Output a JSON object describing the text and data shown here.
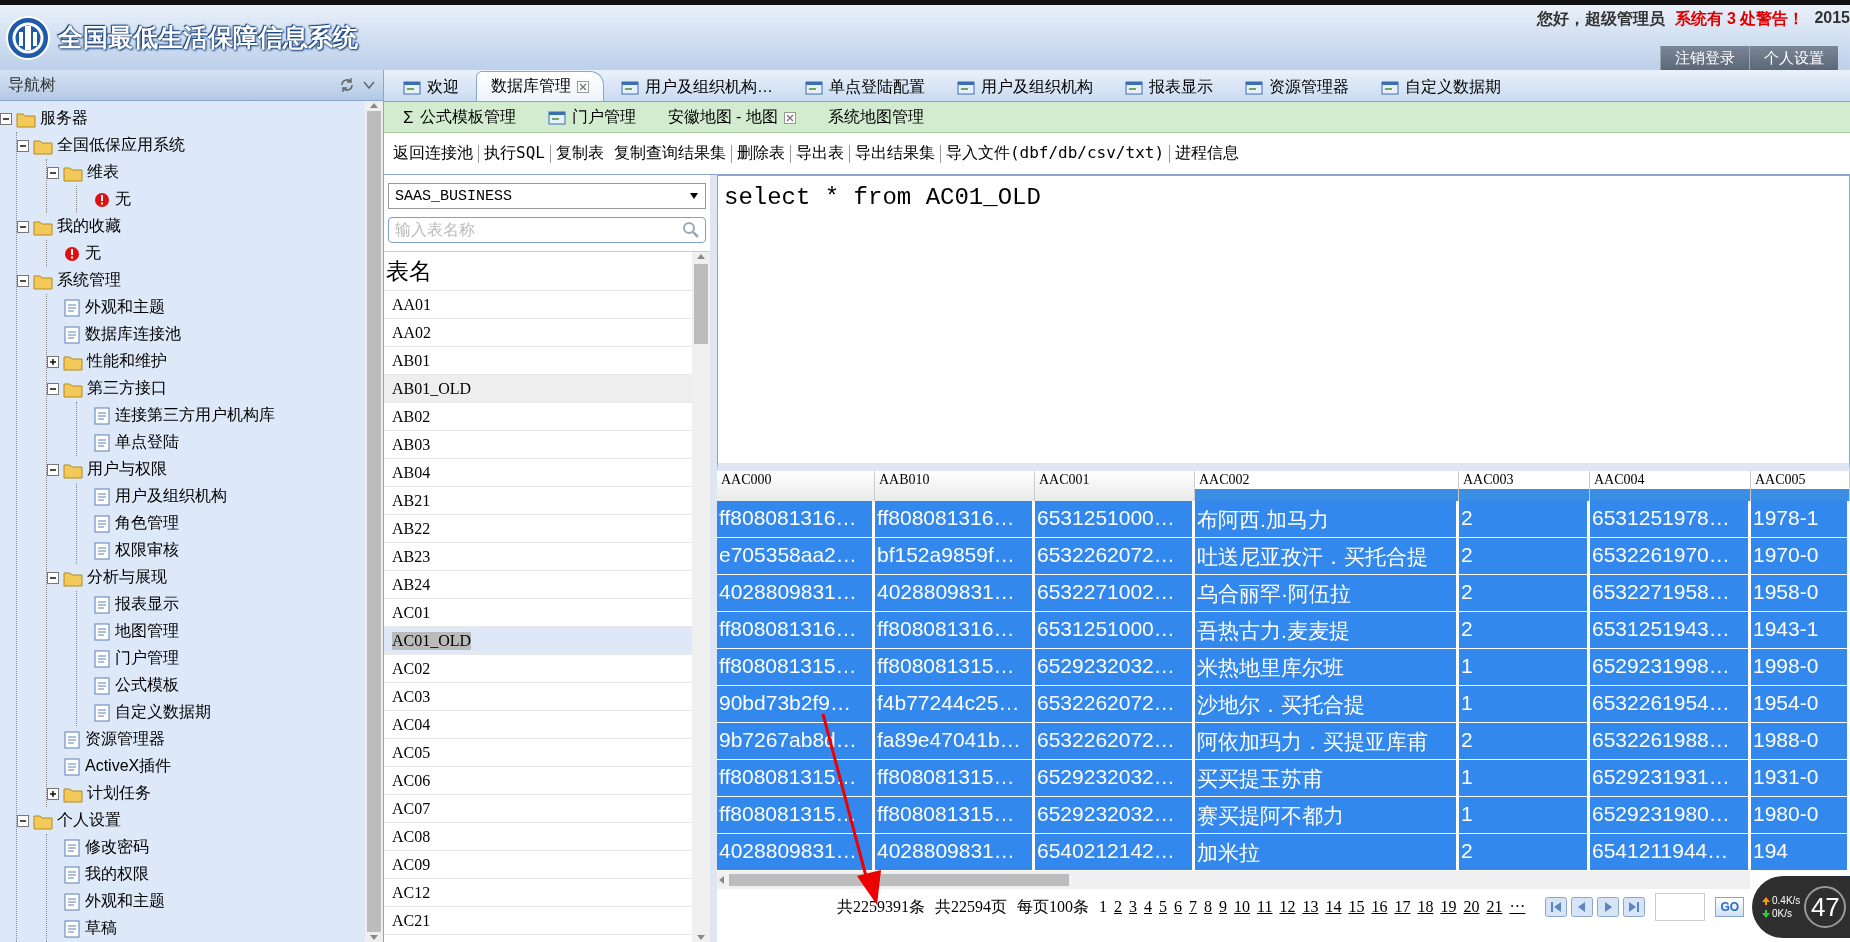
{
  "header": {
    "title": "全国最低生活保障信息系统",
    "greeting": "您好，超级管理员",
    "warning": "系统有 3 处警告！",
    "year": "2015",
    "buttons": [
      "注销登录",
      "个人设置"
    ]
  },
  "nav": {
    "title": "导航树",
    "tree": [
      {
        "label": "服务器",
        "expanded": true,
        "children": [
          {
            "label": "全国低保应用系统",
            "expanded": true,
            "children": [
              {
                "label": "维表",
                "expanded": true,
                "children": [
                  {
                    "label": "无",
                    "kind": "warning"
                  }
                ]
              }
            ]
          },
          {
            "label": "我的收藏",
            "expanded": true,
            "children": [
              {
                "label": "无",
                "kind": "warning"
              }
            ]
          },
          {
            "label": "系统管理",
            "expanded": true,
            "children": [
              {
                "label": "外观和主题"
              },
              {
                "label": "数据库连接池"
              },
              {
                "label": "性能和维护",
                "expanded": false
              },
              {
                "label": "第三方接口",
                "expanded": true,
                "children": [
                  {
                    "label": "连接第三方用户机构库"
                  },
                  {
                    "label": "单点登陆"
                  }
                ]
              },
              {
                "label": "用户与权限",
                "expanded": true,
                "children": [
                  {
                    "label": "用户及组织机构"
                  },
                  {
                    "label": "角色管理"
                  },
                  {
                    "label": "权限审核"
                  }
                ]
              },
              {
                "label": "分析与展现",
                "expanded": true,
                "children": [
                  {
                    "label": "报表显示"
                  },
                  {
                    "label": "地图管理"
                  },
                  {
                    "label": "门户管理"
                  },
                  {
                    "label": "公式模板"
                  },
                  {
                    "label": "自定义数据期"
                  }
                ]
              },
              {
                "label": "资源管理器"
              },
              {
                "label": "ActiveX插件"
              },
              {
                "label": "计划任务",
                "expanded": false
              }
            ]
          },
          {
            "label": "个人设置",
            "expanded": true,
            "children": [
              {
                "label": "修改密码"
              },
              {
                "label": "我的权限"
              },
              {
                "label": "外观和主题"
              },
              {
                "label": "草稿"
              }
            ]
          }
        ]
      }
    ]
  },
  "tabs": [
    {
      "label": "欢迎",
      "selected": false,
      "has_icon": true,
      "closable": false
    },
    {
      "label": "数据库管理",
      "selected": true,
      "has_icon": false,
      "closable": true
    },
    {
      "label": "用户及组织机构…",
      "selected": false,
      "has_icon": true,
      "closable": false
    },
    {
      "label": "单点登陆配置",
      "selected": false,
      "has_icon": true,
      "closable": false
    },
    {
      "label": "用户及组织机构",
      "selected": false,
      "has_icon": true,
      "closable": false
    },
    {
      "label": "报表显示",
      "selected": false,
      "has_icon": true,
      "closable": false
    },
    {
      "label": "资源管理器",
      "selected": false,
      "has_icon": true,
      "closable": false
    },
    {
      "label": "自定义数据期",
      "selected": false,
      "has_icon": true,
      "closable": false
    }
  ],
  "subtabs": [
    {
      "glyph": "Σ",
      "label": "公式模板管理",
      "selected": false,
      "has_icon": false,
      "closable": false
    },
    {
      "label": "门户管理",
      "selected": false,
      "has_icon": true,
      "closable": false
    },
    {
      "label": "安徽地图 - 地图",
      "selected": false,
      "has_icon": false,
      "closable": true
    },
    {
      "label": "系统地图管理",
      "selected": false,
      "has_icon": false,
      "closable": false
    }
  ],
  "toolbar": [
    {
      "label": "返回连接池",
      "divider_after": true
    },
    {
      "label": "执行SQL",
      "divider_after": true
    },
    {
      "label": "复制表",
      "divider_after": false
    },
    {
      "label": "复制查询结果集",
      "divider_after": true
    },
    {
      "label": "删除表",
      "divider_after": true
    },
    {
      "label": "导出表",
      "divider_after": true
    },
    {
      "label": "导出结果集",
      "divider_after": true
    },
    {
      "label": "导入文件(dbf/db/csv/txt)",
      "divider_after": true
    },
    {
      "label": "进程信息",
      "divider_after": false
    }
  ],
  "table_list": {
    "database": "SAAS_BUSINESS",
    "search": {
      "placeholder": "输入表名称"
    },
    "header": "表名",
    "items": [
      {
        "name": "AA01",
        "selected": false,
        "hovered": false
      },
      {
        "name": "AA02",
        "selected": false,
        "hovered": false
      },
      {
        "name": "AB01",
        "selected": false,
        "hovered": false
      },
      {
        "name": "AB01_OLD",
        "selected": false,
        "hovered": true
      },
      {
        "name": "AB02",
        "selected": false,
        "hovered": false
      },
      {
        "name": "AB03",
        "selected": false,
        "hovered": false
      },
      {
        "name": "AB04",
        "selected": false,
        "hovered": false
      },
      {
        "name": "AB21",
        "selected": false,
        "hovered": false
      },
      {
        "name": "AB22",
        "selected": false,
        "hovered": false
      },
      {
        "name": "AB23",
        "selected": false,
        "hovered": false
      },
      {
        "name": "AB24",
        "selected": false,
        "hovered": false
      },
      {
        "name": "AC01",
        "selected": false,
        "hovered": false
      },
      {
        "name": "AC01_OLD",
        "selected": true,
        "hovered": false
      },
      {
        "name": "AC02",
        "selected": false,
        "hovered": false
      },
      {
        "name": "AC03",
        "selected": false,
        "hovered": false
      },
      {
        "name": "AC04",
        "selected": false,
        "hovered": false
      },
      {
        "name": "AC05",
        "selected": false,
        "hovered": false
      },
      {
        "name": "AC06",
        "selected": false,
        "hovered": false
      },
      {
        "name": "AC07",
        "selected": false,
        "hovered": false
      },
      {
        "name": "AC08",
        "selected": false,
        "hovered": false
      },
      {
        "name": "AC09",
        "selected": false,
        "hovered": false
      },
      {
        "name": "AC12",
        "selected": false,
        "hovered": false
      },
      {
        "name": "AC21",
        "selected": false,
        "hovered": false
      }
    ]
  },
  "sql_editor": {
    "value": "select * from AC01_OLD"
  },
  "grid": {
    "columns": [
      {
        "label": "AAC000",
        "selected": false
      },
      {
        "label": "AAB010",
        "selected": false
      },
      {
        "label": "AAC001",
        "selected": false
      },
      {
        "label": "AAC002",
        "selected": true
      },
      {
        "label": "AAC003",
        "selected": true
      },
      {
        "label": "AAC004",
        "selected": true
      },
      {
        "label": "AAC005",
        "selected": true
      }
    ],
    "rows": [
      {
        "selected": true,
        "cells": [
          "ff808081316…",
          "ff808081316…",
          "6531251000…",
          "布阿西.加马力",
          "2",
          "6531251978…",
          "1978-1"
        ]
      },
      {
        "selected": true,
        "cells": [
          "e705358aa2…",
          "bf152a9859f…",
          "6532262072…",
          "吐送尼亚孜汗．买托合提",
          "2",
          "6532261970…",
          "1970-0"
        ]
      },
      {
        "selected": true,
        "cells": [
          "4028809831…",
          "4028809831…",
          "6532271002…",
          "乌合丽罕·阿伍拉",
          "2",
          "6532271958…",
          "1958-0"
        ]
      },
      {
        "selected": true,
        "cells": [
          "ff808081316…",
          "ff808081316…",
          "6531251000…",
          "吾热古力.麦麦提",
          "2",
          "6531251943…",
          "1943-1"
        ]
      },
      {
        "selected": true,
        "cells": [
          "ff808081315…",
          "ff808081315…",
          "6529232032…",
          "米热地里库尔班",
          "1",
          "6529231998…",
          "1998-0"
        ]
      },
      {
        "selected": true,
        "cells": [
          "90bd73b2f9…",
          "f4b77244c25…",
          "6532262072…",
          "沙地尔．买托合提",
          "1",
          "6532261954…",
          "1954-0"
        ]
      },
      {
        "selected": true,
        "cells": [
          "9b7267ab8d…",
          "fa89e47041b…",
          "6532262072…",
          "阿依加玛力．买提亚库甫",
          "2",
          "6532261988…",
          "1988-0"
        ]
      },
      {
        "selected": true,
        "cells": [
          "ff808081315…",
          "ff808081315…",
          "6529232032…",
          "买买提玉苏甫",
          "1",
          "6529231931…",
          "1931-0"
        ]
      },
      {
        "selected": true,
        "cells": [
          "ff808081315…",
          "ff808081315…",
          "6529232032…",
          "赛买提阿不都力",
          "1",
          "6529231980…",
          "1980-0"
        ]
      },
      {
        "selected": true,
        "cells": [
          "4028809831…",
          "4028809831…",
          "6540212142…",
          "加米拉",
          "2",
          "6541211944…",
          "194"
        ]
      }
    ]
  },
  "pager": {
    "total": "共2259391条",
    "pages_total": "共22594页",
    "per_page": "每页100条",
    "pages": [
      {
        "label": "1",
        "selected": true
      },
      {
        "label": "2",
        "selected": false
      },
      {
        "label": "3",
        "selected": false
      },
      {
        "label": "4",
        "selected": false
      },
      {
        "label": "5",
        "selected": false
      },
      {
        "label": "6",
        "selected": false
      },
      {
        "label": "7",
        "selected": false
      },
      {
        "label": "8",
        "selected": false
      },
      {
        "label": "9",
        "selected": false
      },
      {
        "label": "10",
        "selected": false
      },
      {
        "label": "11",
        "selected": false
      },
      {
        "label": "12",
        "selected": false
      },
      {
        "label": "13",
        "selected": false
      },
      {
        "label": "14",
        "selected": false
      },
      {
        "label": "15",
        "selected": false
      },
      {
        "label": "16",
        "selected": false
      },
      {
        "label": "17",
        "selected": false
      },
      {
        "label": "18",
        "selected": false
      },
      {
        "label": "19",
        "selected": false
      },
      {
        "label": "20",
        "selected": false
      },
      {
        "label": "21",
        "selected": false
      },
      {
        "label": "···",
        "selected": false
      }
    ],
    "go": "GO"
  },
  "net_widget": {
    "upload": "0.4K/s",
    "download": "0K/s",
    "percent": "47"
  }
}
